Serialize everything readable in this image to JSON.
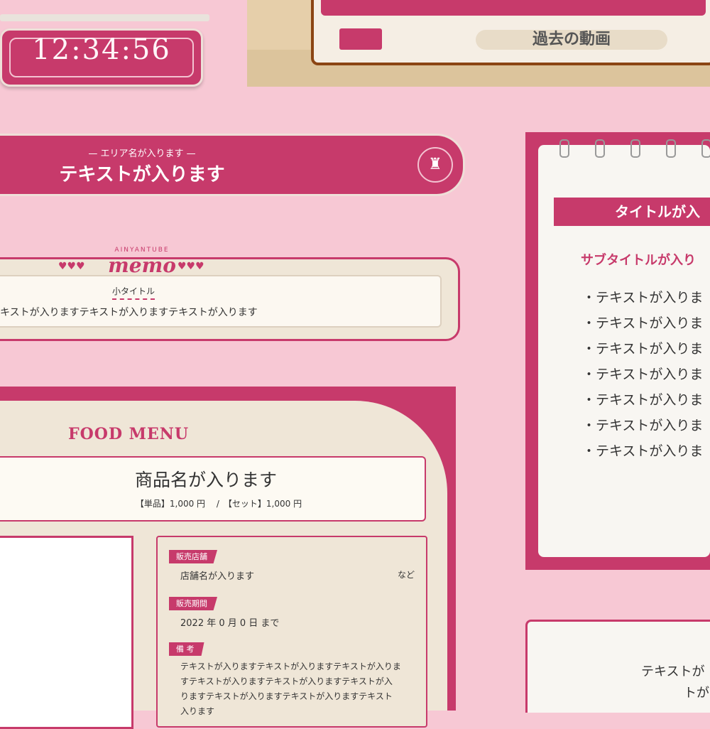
{
  "clock": {
    "time": "12:34:56"
  },
  "tv": {
    "label": "過去の動画"
  },
  "area_banner": {
    "subtitle": "エリア名が入ります",
    "title": "テキストが入ります",
    "icon": "castle-icon"
  },
  "memo": {
    "brand": "AINYANTUBE",
    "word": "memo",
    "small_title": "小タイトル",
    "text": "キストが入りますテキストが入りますテキストが入ります"
  },
  "food_menu": {
    "title": "FOOD MENU",
    "product_name": "商品名が入ります",
    "price_line": "【単品】1,000 円　 /　【セット】1,000 円",
    "shop_tag": "販売店舗",
    "shop_name": "店舗名が入ります",
    "shop_suffix": "など",
    "period_tag": "販売期間",
    "period": "2022 年 0 月 0 日 まで",
    "note_tag": "備 考",
    "note_lines": [
      "テキストが入りますテキストが入りますテキストが入りま",
      "すテキストが入りますテキストが入りますテキストが入",
      "りますテキストが入りますテキストが入りますテキスト",
      "入ります"
    ]
  },
  "notebook": {
    "title": "タイトルが入",
    "subtitle": "サブタイトルが入り",
    "items": [
      "・テキストが入りま",
      "・テキストが入りま",
      "・テキストが入りま",
      "・テキストが入りま",
      "・テキストが入りま",
      "・テキストが入りま",
      "・テキストが入りま"
    ]
  },
  "bottom_panel": {
    "line1": "テキストが",
    "line2": "トが"
  },
  "colors": {
    "accent": "#c73a6b",
    "background": "#f7c8d4",
    "paper": "#efe6d7"
  }
}
